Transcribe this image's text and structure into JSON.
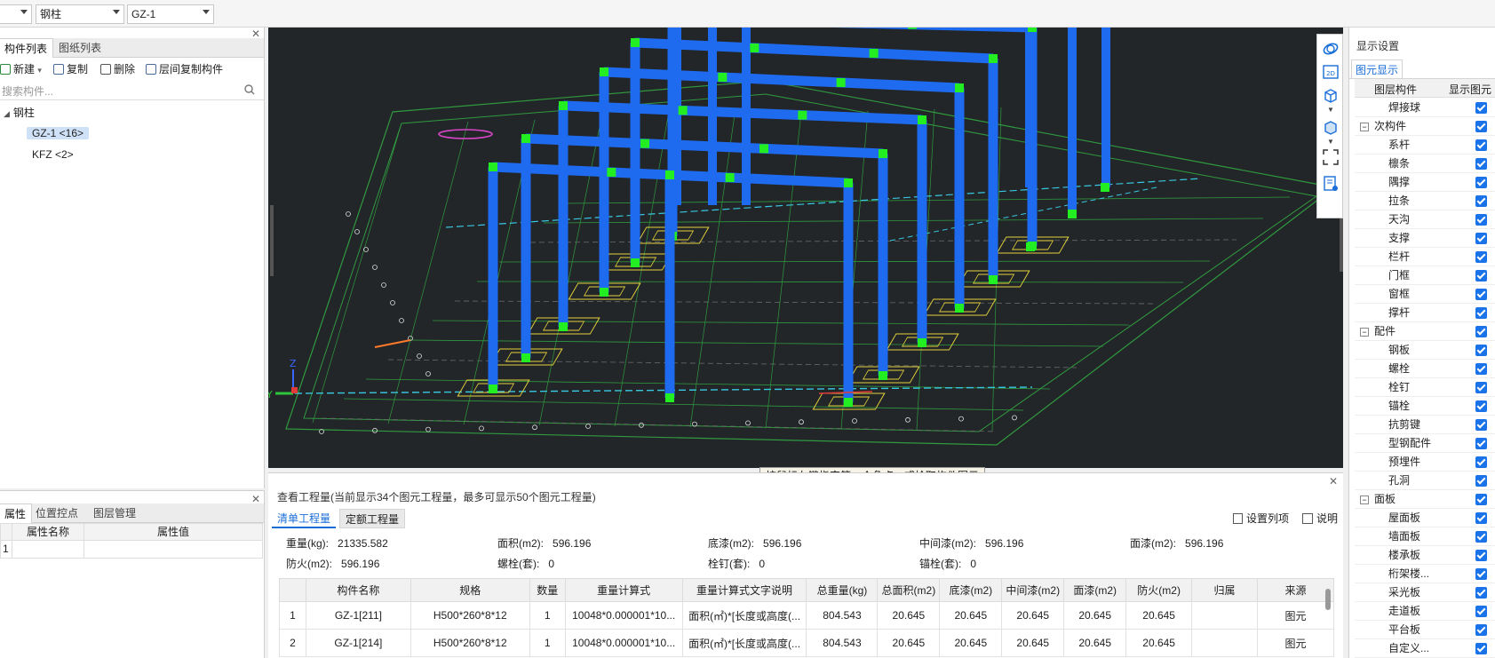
{
  "topbar": {
    "combo1": "",
    "combo2": "钢柱",
    "combo3": "GZ-1"
  },
  "left_top": {
    "tabs": [
      "构件列表",
      "图纸列表"
    ],
    "tools": [
      "新建",
      "复制",
      "删除",
      "层间复制构件"
    ],
    "search_placeholder": "搜索构件...",
    "tree": {
      "root": "钢柱",
      "children": [
        "GZ-1 <16>",
        "KFZ <2>"
      ]
    }
  },
  "left_bottom": {
    "tabs": [
      "属性",
      "位置控点",
      "图层管理"
    ],
    "headers": [
      "属性名称",
      "属性值"
    ],
    "row1_index": "1"
  },
  "viewport": {
    "hint": "按鼠标左键指定第一个角点，或拾取构件图元",
    "axis_x": "Y",
    "axis_z": "Z"
  },
  "view_tools": [
    "orbit-icon",
    "2d-icon",
    "3d-box-icon",
    "3d-cube-icon",
    "fit-view-icon",
    "view-settings-icon"
  ],
  "qty": {
    "title": "查看工程量(当前显示34个图元工程量，最多可显示50个图元工程量)",
    "tabs": [
      "清单工程量",
      "定额工程量"
    ],
    "links": [
      "设置列项",
      "说明"
    ],
    "summary": [
      {
        "label": "重量(kg):",
        "value": "21335.582"
      },
      {
        "label": "面积(m2):",
        "value": "596.196"
      },
      {
        "label": "底漆(m2):",
        "value": "596.196"
      },
      {
        "label": "中间漆(m2):",
        "value": "596.196"
      },
      {
        "label": "面漆(m2):",
        "value": "596.196"
      },
      {
        "label": "防火(m2):",
        "value": "596.196"
      },
      {
        "label": "螺栓(套):",
        "value": "0"
      },
      {
        "label": "栓钉(套):",
        "value": "0"
      },
      {
        "label": "锚栓(套):",
        "value": "0"
      }
    ],
    "columns": [
      "",
      "构件名称",
      "规格",
      "数量",
      "重量计算式",
      "重量计算式文字说明",
      "总重量(kg)",
      "总面积(m2)",
      "底漆(m2)",
      "中间漆(m2)",
      "面漆(m2)",
      "防火(m2)",
      "归属",
      "来源"
    ],
    "rows": [
      [
        "1",
        "GZ-1[211]",
        "H500*260*8*12",
        "1",
        "10048*0.000001*10...",
        "面积(㎡)*[长度或高度(...",
        "804.543",
        "20.645",
        "20.645",
        "20.645",
        "20.645",
        "20.645",
        "",
        "图元"
      ],
      [
        "2",
        "GZ-1[214]",
        "H500*260*8*12",
        "1",
        "10048*0.000001*10...",
        "面积(㎡)*[长度或高度(...",
        "804.543",
        "20.645",
        "20.645",
        "20.645",
        "20.645",
        "20.645",
        "",
        "图元"
      ]
    ]
  },
  "right": {
    "title": "显示设置",
    "tab": "图元显示",
    "col1": "图层构件",
    "col2": "显示图元",
    "items": [
      {
        "label": "焊接球",
        "level": 2
      },
      {
        "label": "次构件",
        "level": 1
      },
      {
        "label": "系杆",
        "level": 2
      },
      {
        "label": "檩条",
        "level": 2
      },
      {
        "label": "隅撑",
        "level": 2
      },
      {
        "label": "拉条",
        "level": 2
      },
      {
        "label": "天沟",
        "level": 2
      },
      {
        "label": "支撑",
        "level": 2
      },
      {
        "label": "栏杆",
        "level": 2
      },
      {
        "label": "门框",
        "level": 2
      },
      {
        "label": "窗框",
        "level": 2
      },
      {
        "label": "撑杆",
        "level": 2
      },
      {
        "label": "配件",
        "level": 1
      },
      {
        "label": "钢板",
        "level": 2
      },
      {
        "label": "螺栓",
        "level": 2
      },
      {
        "label": "栓钉",
        "level": 2
      },
      {
        "label": "锚栓",
        "level": 2
      },
      {
        "label": "抗剪键",
        "level": 2
      },
      {
        "label": "型钢配件",
        "level": 2
      },
      {
        "label": "预埋件",
        "level": 2
      },
      {
        "label": "孔洞",
        "level": 2
      },
      {
        "label": "面板",
        "level": 1
      },
      {
        "label": "屋面板",
        "level": 2
      },
      {
        "label": "墙面板",
        "level": 2
      },
      {
        "label": "楼承板",
        "level": 2
      },
      {
        "label": "桁架楼...",
        "level": 2
      },
      {
        "label": "采光板",
        "level": 2
      },
      {
        "label": "走道板",
        "level": 2
      },
      {
        "label": "平台板",
        "level": 2
      },
      {
        "label": "自定义...",
        "level": 2
      }
    ]
  }
}
